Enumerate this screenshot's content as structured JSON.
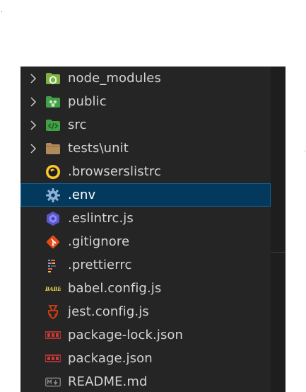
{
  "explorer": {
    "items": [
      {
        "label": "node_modules",
        "kind": "folder",
        "icon": "node-modules-folder-icon",
        "color": "#8bc34a"
      },
      {
        "label": "public",
        "kind": "folder",
        "icon": "public-folder-icon",
        "color": "#4caf50"
      },
      {
        "label": "src",
        "kind": "folder",
        "icon": "src-folder-icon",
        "color": "#4caf50"
      },
      {
        "label": "tests\\unit",
        "kind": "folder",
        "icon": "folder-icon",
        "color": "#c09553"
      },
      {
        "label": ".browserslistrc",
        "kind": "file",
        "icon": "browserslist-icon",
        "color": "#ffca28"
      },
      {
        "label": ".env",
        "kind": "file",
        "icon": "gear-icon",
        "color": "#8db1d6",
        "selected": true
      },
      {
        "label": ".eslintrc.js",
        "kind": "file",
        "icon": "eslint-icon",
        "color": "#6f6ae0"
      },
      {
        "label": ".gitignore",
        "kind": "file",
        "icon": "git-icon",
        "color": "#e64a19"
      },
      {
        "label": ".prettierrc",
        "kind": "file",
        "icon": "prettier-icon",
        "color": "#56b3b4"
      },
      {
        "label": "babel.config.js",
        "kind": "file",
        "icon": "babel-icon",
        "color": "#f5da55"
      },
      {
        "label": "jest.config.js",
        "kind": "file",
        "icon": "jest-icon",
        "color": "#c63d14"
      },
      {
        "label": "package-lock.json",
        "kind": "file",
        "icon": "npm-icon",
        "color": "#cb3837"
      },
      {
        "label": "package.json",
        "kind": "file",
        "icon": "npm-icon",
        "color": "#cb3837"
      },
      {
        "label": "README.md",
        "kind": "file",
        "icon": "markdown-icon",
        "color": "#8a8a8a"
      }
    ]
  }
}
